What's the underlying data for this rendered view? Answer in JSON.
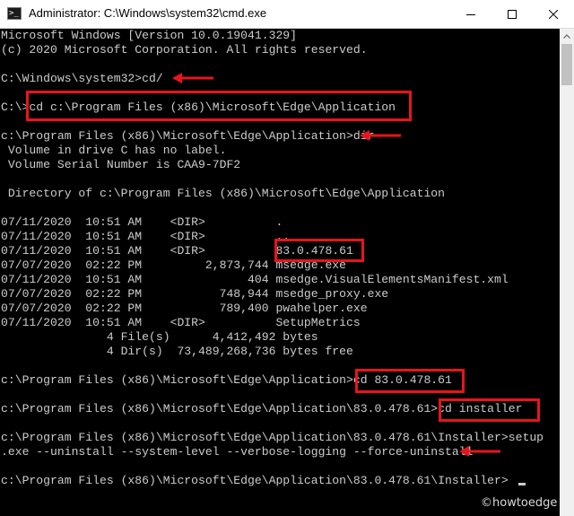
{
  "window": {
    "icon": "cmd-icon",
    "title": "Administrator: C:\\Windows\\system32\\cmd.exe",
    "controls": [
      "minimize-icon",
      "maximize-icon",
      "close-icon"
    ]
  },
  "console": {
    "colors": {
      "background": "#000000",
      "text": "#cccccc",
      "highlight": "#e8141b",
      "titlebar": "#ffffff"
    },
    "lines": [
      "Microsoft Windows [Version 10.0.19041.329]",
      "(c) 2020 Microsoft Corporation. All rights reserved.",
      "",
      "C:\\Windows\\system32>cd/",
      "",
      "C:\\>cd c:\\Program Files (x86)\\Microsoft\\Edge\\Application",
      "",
      "c:\\Program Files (x86)\\Microsoft\\Edge\\Application>dir",
      " Volume in drive C has no label.",
      " Volume Serial Number is CAA9-7DF2",
      "",
      " Directory of c:\\Program Files (x86)\\Microsoft\\Edge\\Application",
      "",
      "07/11/2020  10:51 AM    <DIR>          .",
      "07/11/2020  10:51 AM    <DIR>          ..",
      "07/11/2020  10:51 AM    <DIR>          83.0.478.61",
      "07/07/2020  02:22 PM         2,873,744 msedge.exe",
      "07/11/2020  10:51 AM               404 msedge.VisualElementsManifest.xml",
      "07/07/2020  02:22 PM           748,944 msedge_proxy.exe",
      "07/07/2020  02:22 PM           789,400 pwahelper.exe",
      "07/11/2020  10:51 AM    <DIR>          SetupMetrics",
      "               4 File(s)      4,412,492 bytes",
      "               4 Dir(s)  73,489,268,736 bytes free",
      "",
      "c:\\Program Files (x86)\\Microsoft\\Edge\\Application>cd 83.0.478.61",
      "",
      "c:\\Program Files (x86)\\Microsoft\\Edge\\Application\\83.0.478.61>cd installer",
      "",
      "c:\\Program Files (x86)\\Microsoft\\Edge\\Application\\83.0.478.61\\Installer>setup",
      ".exe --uninstall --system-level --verbose-logging --force-uninstall",
      "",
      "c:\\Program Files (x86)\\Microsoft\\Edge\\Application\\83.0.478.61\\Installer>"
    ]
  },
  "watermark": "©howtoedge"
}
